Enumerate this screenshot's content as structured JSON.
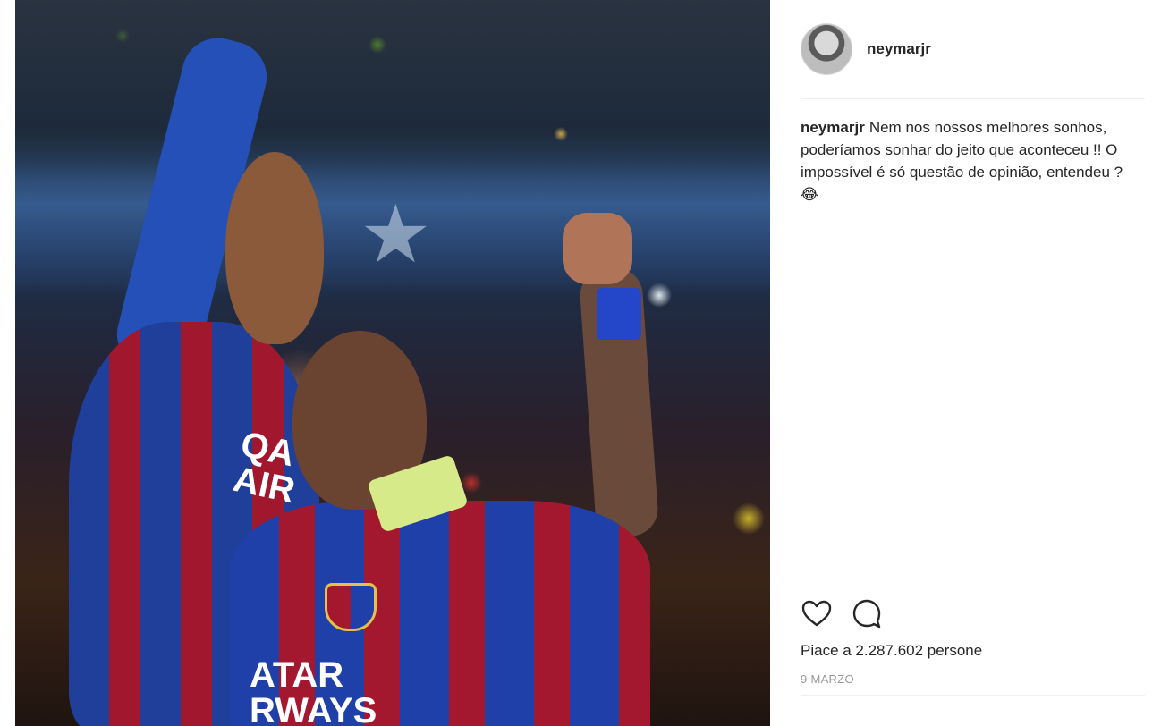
{
  "post": {
    "username": "neymarjr",
    "photo": {
      "sponsor_top": "QA\nAIR",
      "sponsor_bottom": "ATAR\nRWAYS"
    },
    "caption": {
      "username": "neymarjr",
      "text": "Nem nos nossos melhores sonhos, poderíamos sonhar do jeito que aconteceu !! O impossível é só questão de opinião, entendeu ? 😂"
    },
    "actions": {
      "like_icon": "heart-icon",
      "comment_icon": "comment-icon"
    },
    "likes": "Piace a 2.287.602 persone",
    "date": "9 MARZO"
  }
}
